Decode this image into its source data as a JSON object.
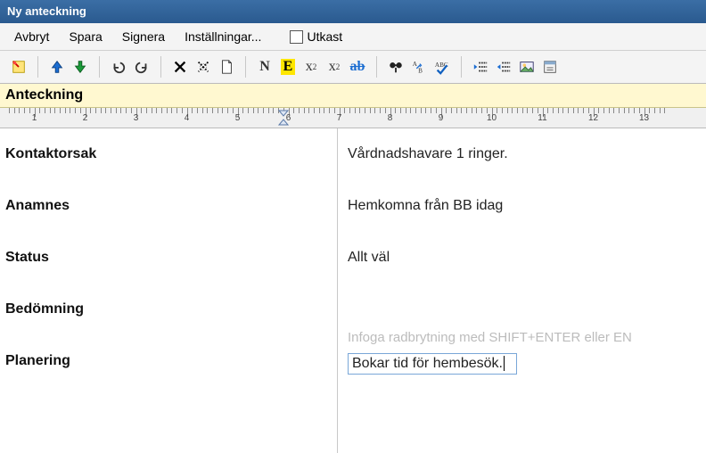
{
  "window": {
    "title": "Ny anteckning"
  },
  "menu": {
    "cancel": "Avbryt",
    "save": "Spara",
    "sign": "Signera",
    "settings": "Inställningar...",
    "draft": "Utkast"
  },
  "section": {
    "heading": "Anteckning"
  },
  "ruler": {
    "start": 1,
    "end": 13,
    "markerAt": 6.4,
    "unitPx": 57
  },
  "icons": {
    "new": "new-note",
    "up": "arrow-up",
    "down": "arrow-down",
    "undo": "undo",
    "redo": "redo",
    "delete": "delete-x",
    "clearfmt": "clear-format",
    "page": "page",
    "normal": "N",
    "emph": "E",
    "sup": "x²",
    "sub": "x₂",
    "strike": "ab",
    "find": "binoculars",
    "findrepl": "find-replace",
    "spell": "spellcheck",
    "outdent": "outdent",
    "indent": "indent",
    "img": "image",
    "misc": "misc"
  },
  "fields": [
    {
      "label": "Kontaktorsak",
      "value": "Vårdnadshavare 1 ringer."
    },
    {
      "label": "Anamnes",
      "value": "Hemkomna från BB idag"
    },
    {
      "label": "Status",
      "value": "Allt väl"
    },
    {
      "label": "Bedömning",
      "value": ""
    },
    {
      "label": "Planering",
      "value": "Bokar tid för hembesök.",
      "editing": true,
      "hint": "Infoga radbrytning med SHIFT+ENTER eller EN"
    }
  ]
}
